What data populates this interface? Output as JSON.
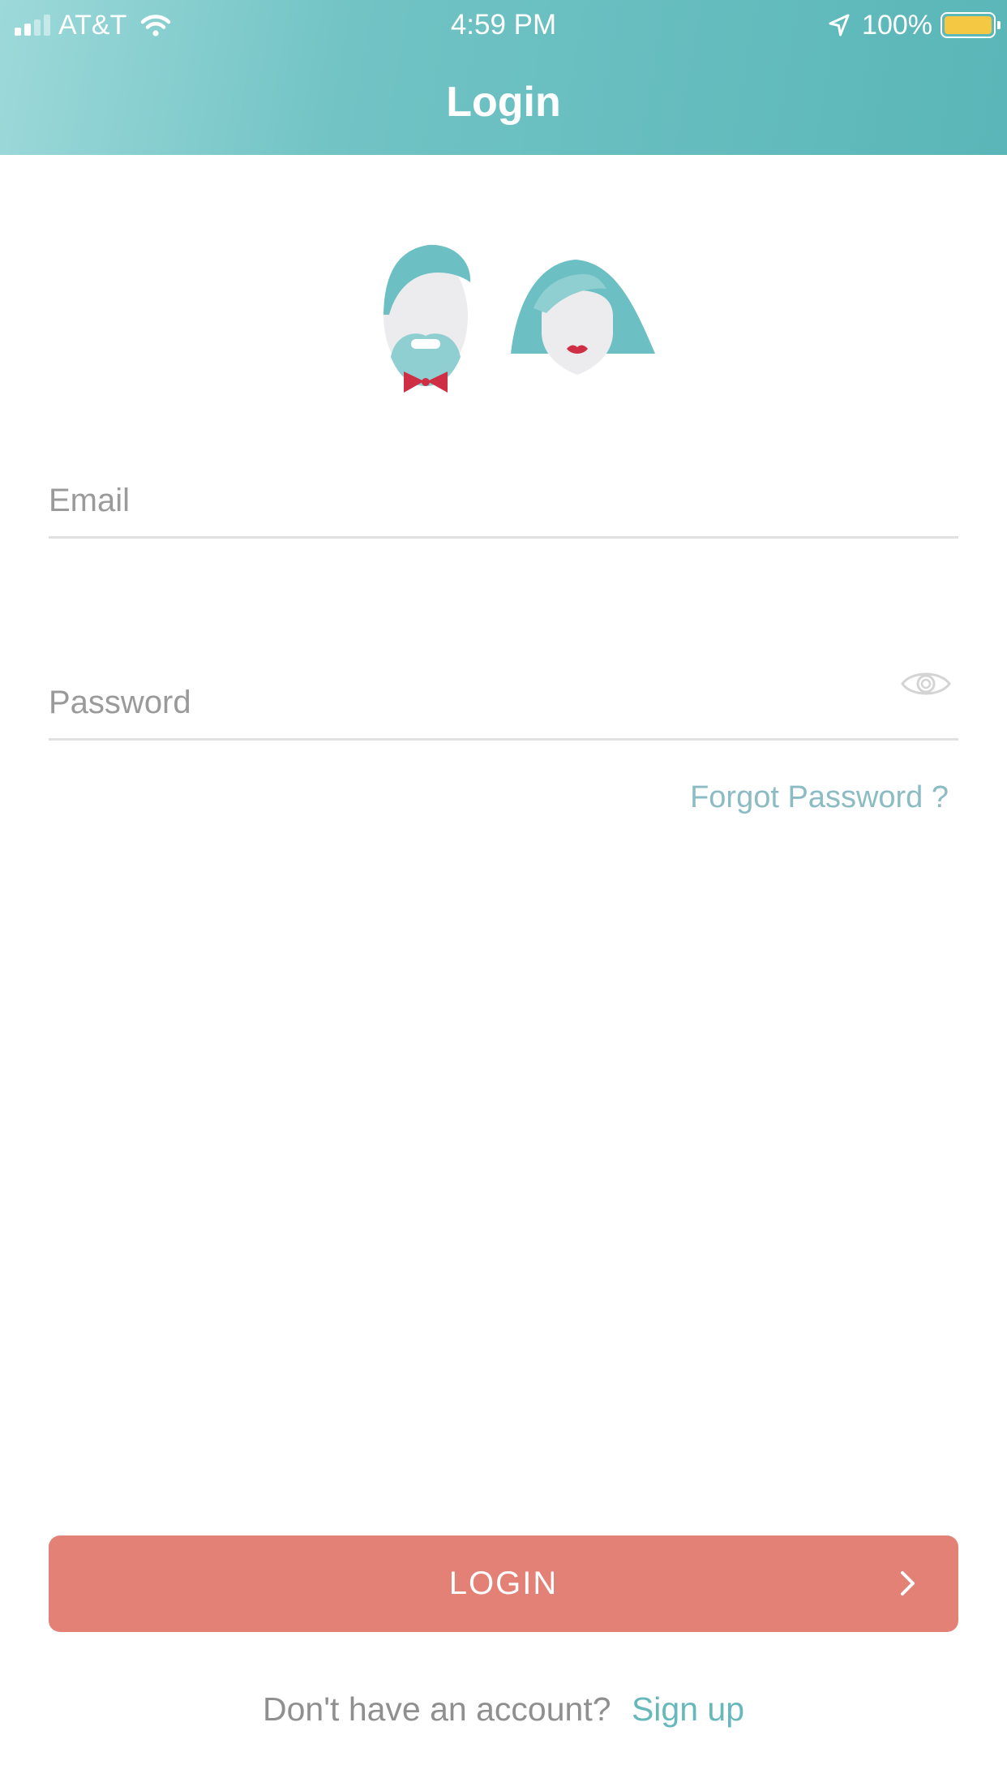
{
  "status_bar": {
    "carrier": "AT&T",
    "time": "4:59 PM",
    "battery": "100%",
    "signal_icon": "cellular-signal-icon",
    "wifi_icon": "wifi-icon",
    "location_icon": "location-arrow-icon",
    "battery_icon": "battery-icon",
    "battery_level": 1.0
  },
  "nav": {
    "title": "Login"
  },
  "illustration": {
    "icon": "couple-avatars-icon"
  },
  "form": {
    "email": {
      "placeholder": "Email",
      "value": ""
    },
    "password": {
      "placeholder": "Password",
      "value": "",
      "toggle_icon": "eye-icon"
    },
    "forgot_label": "Forgot Password ?"
  },
  "login_button": {
    "label": "LOGIN",
    "icon": "chevron-right-icon"
  },
  "signup": {
    "prompt": "Don't have an account?",
    "link": "Sign up"
  },
  "colors": {
    "header_start": "#9dd9da",
    "header_end": "#5ab6b8",
    "accent": "#67b8bb",
    "login_button": "#e48177",
    "bow_tie": "#d23045",
    "battery": "#f4c842"
  }
}
